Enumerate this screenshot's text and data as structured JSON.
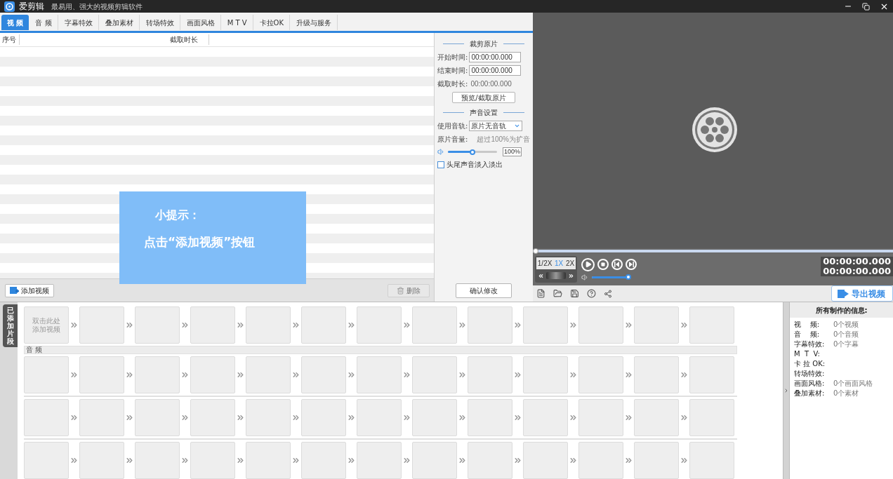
{
  "window": {
    "title": "爱剪辑",
    "subtitle": "最易用、强大的视频剪辑软件"
  },
  "tabs": [
    {
      "label": "视 频",
      "selected": true
    },
    {
      "label": "音 频",
      "selected": false
    },
    {
      "label": "字幕特效",
      "selected": false
    },
    {
      "label": "叠加素材",
      "selected": false
    },
    {
      "label": "转场特效",
      "selected": false
    },
    {
      "label": "画面风格",
      "selected": false
    },
    {
      "label": "M T V",
      "selected": false
    },
    {
      "label": "卡拉OK",
      "selected": false
    },
    {
      "label": "升级与服务",
      "selected": false
    }
  ],
  "clip_list": {
    "columns": [
      "序号",
      "截取时长"
    ]
  },
  "list_buttons": [
    {
      "label": "添加视频",
      "kind": "add",
      "disabled": false
    },
    {
      "label": "删除",
      "kind": "delete",
      "disabled": true
    }
  ],
  "tip": {
    "title": "小提示：",
    "text": "点击“添加视频”按钮"
  },
  "trim_panel": {
    "title": "裁剪原片",
    "start_label": "开始时间:",
    "start_value": "00:00:00.000",
    "end_label": "结束时间:",
    "end_value": "00:00:00.000",
    "duration_label": "截取时长:",
    "duration_value": "00:00:00.000",
    "preview_button": "预览/截取原片"
  },
  "sound_panel": {
    "title": "声音设置",
    "track_label": "使用音轨:",
    "track_value": "原片无音轨",
    "volume_label": "原片音量:",
    "volume_hint": "超过100%为扩音",
    "volume": {
      "level": 0.5,
      "reading": "100%"
    },
    "fade": {
      "label": "头尾声音淡入淡出",
      "checked": false
    }
  },
  "confirm_button": "确认修改",
  "player": {
    "seek": {
      "level": 0
    },
    "speeds": [
      {
        "label": "1/2X",
        "selected": false
      },
      {
        "label": "1X",
        "selected": true
      },
      {
        "label": "2X",
        "selected": false
      }
    ],
    "volume": {
      "level": 1
    },
    "current_time": "00:00:00.000",
    "total_time": "00:00:00.000",
    "export_button": "导出视频"
  },
  "timeline": {
    "side_label": "已添加片段",
    "tracks": [
      {
        "kind": "clips",
        "hint": "双击此处添加视频"
      },
      {
        "kind": "separator",
        "label": "音 频"
      },
      {
        "kind": "clips"
      },
      {
        "kind": "separator"
      },
      {
        "kind": "clips"
      },
      {
        "kind": "separator"
      },
      {
        "kind": "clips"
      }
    ]
  },
  "info_panel": {
    "title": "所有制作的信息:",
    "rows": [
      {
        "label": "视    频:",
        "value": "0个视频"
      },
      {
        "label": "音    频:",
        "value": "0个音频"
      },
      {
        "label": "字幕特效:",
        "value": "0个字幕"
      },
      {
        "label": "M  T  V:"
      },
      {
        "label": "卡 拉 OK:"
      },
      {
        "label": "转场特效:"
      },
      {
        "label": "画面风格:",
        "value": "0个画面风格"
      },
      {
        "label": "叠加素材:",
        "value": "0个素材"
      }
    ]
  }
}
